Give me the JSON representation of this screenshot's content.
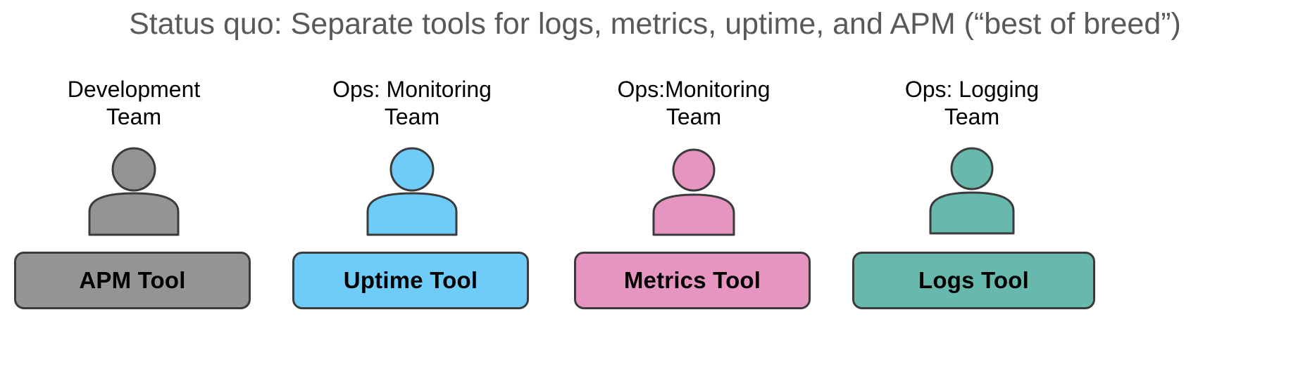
{
  "slide": {
    "title": "Status quo: Separate tools for logs, metrics, uptime, and APM (“best of breed”)",
    "background_color": "#ffffff",
    "title_color": "#595959",
    "outline_color": "#3b3b3b"
  },
  "columns": [
    {
      "team_label": "Development\nTeam",
      "person_icon": "person-icon",
      "tool_label": "APM Tool",
      "color": "#949494"
    },
    {
      "team_label": "Ops: Monitoring\nTeam",
      "person_icon": "person-icon",
      "tool_label": "Uptime Tool",
      "color": "#6fcbf8"
    },
    {
      "team_label": "Ops:Monitoring\nTeam",
      "person_icon": "person-icon",
      "tool_label": "Metrics Tool",
      "color": "#e694c0"
    },
    {
      "team_label": "Ops: Logging\nTeam",
      "person_icon": "person-icon",
      "tool_label": "Logs Tool",
      "color": "#68b9ad"
    }
  ]
}
